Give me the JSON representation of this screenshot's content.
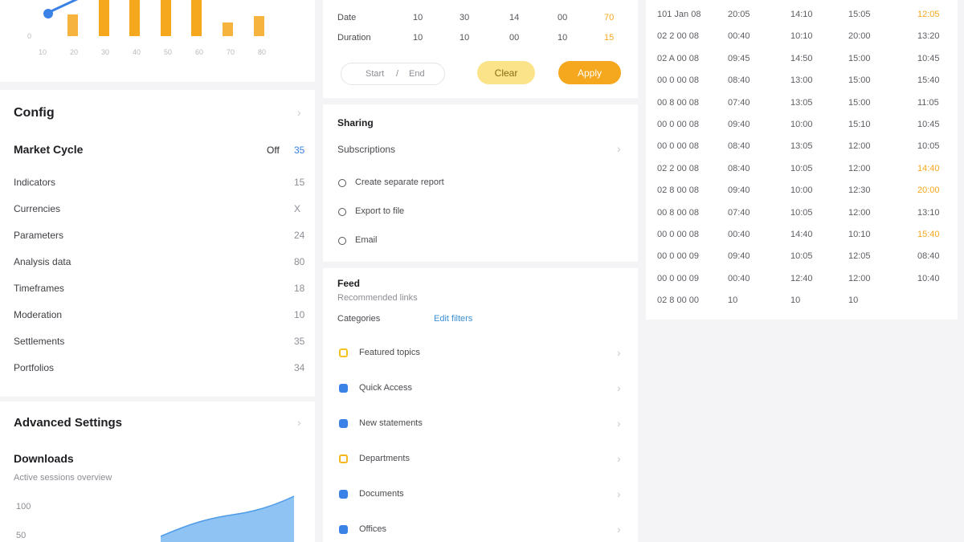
{
  "colors": {
    "accent": "#f5a71d",
    "accent_light": "#fbe38a",
    "blue": "#3b82e6",
    "area_blue": "#7ab8f2"
  },
  "top_chart": {
    "x_ticks": [
      "10",
      "20",
      "30",
      "40",
      "50",
      "60",
      "70",
      "80"
    ],
    "y_tick": "0"
  },
  "config": {
    "title": "Config",
    "header_label": "Market Cycle",
    "header_val1": "Off",
    "header_val2": "35",
    "items": [
      {
        "label": "Indicators",
        "value": "15"
      },
      {
        "label": "Currencies",
        "value": "X"
      },
      {
        "label": "Parameters",
        "value": "24"
      },
      {
        "label": "Analysis data",
        "value": "80"
      },
      {
        "label": "Timeframes",
        "value": "18"
      },
      {
        "label": "Moderation",
        "value": "10"
      },
      {
        "label": "Settlements",
        "value": "35"
      },
      {
        "label": "Portfolios",
        "value": "34"
      }
    ]
  },
  "advanced": {
    "title": "Advanced Settings",
    "subtitle": "Downloads",
    "caption": "Active sessions overview",
    "y_top": "100",
    "y_bottom": "50"
  },
  "mid_table": {
    "rows": [
      {
        "label": "Date",
        "cells": [
          "10",
          "30",
          "14",
          "00",
          "70"
        ]
      },
      {
        "label": "Duration",
        "cells": [
          "10",
          "10",
          "00",
          "10",
          "15"
        ]
      }
    ],
    "range_from": "Start",
    "range_to": "End",
    "btn_clear": "Clear",
    "btn_apply": "Apply"
  },
  "sharing": {
    "title": "Sharing",
    "subtitle": "Subscriptions",
    "options": [
      "Create separate report",
      "Export to file",
      "Email"
    ]
  },
  "feed": {
    "title": "Feed",
    "subtitle": "Recommended links",
    "link_label": "Categories",
    "link_value": "Edit filters",
    "items": [
      {
        "label": "Featured topics",
        "color": "#f5c21d"
      },
      {
        "label": "Quick Access",
        "color": "#3b82e6"
      },
      {
        "label": "New statements",
        "color": "#3b82e6"
      },
      {
        "label": "Departments",
        "color": "#f5b51d"
      },
      {
        "label": "Documents",
        "color": "#3b82e6"
      },
      {
        "label": "Offices",
        "color": "#3b82e6"
      }
    ]
  },
  "right_table": {
    "rows": [
      [
        "101 Jan 08",
        "20:05",
        "14:10",
        "15:05",
        "12:05"
      ],
      [
        "02 2 00 08",
        "00:40",
        "10:10",
        "20:00",
        "13:20"
      ],
      [
        "02 A 00 08",
        "09:45",
        "14:50",
        "15:00",
        "10:45"
      ],
      [
        "00 0 00 08",
        "08:40",
        "13:00",
        "15:00",
        "15:40"
      ],
      [
        "00 8 00 08",
        "07:40",
        "13:05",
        "15:00",
        "11:05"
      ],
      [
        "00 0 00 08",
        "09:40",
        "10:00",
        "15:10",
        "10:45"
      ],
      [
        "00 0 00 08",
        "08:40",
        "13:05",
        "12:00",
        "10:05"
      ],
      [
        "02 2 00 08",
        "08:40",
        "10:05",
        "12:00",
        "14:40"
      ],
      [
        "02 8 00 08",
        "09:40",
        "10:00",
        "12:30",
        "20:00"
      ],
      [
        "00 8 00 08",
        "07:40",
        "10:05",
        "12:00",
        "13:10"
      ],
      [
        "00 0 00 08",
        "00:40",
        "14:40",
        "10:10",
        "15:40"
      ],
      [
        "00 0 00 09",
        "09:40",
        "10:05",
        "12:05",
        "08:40"
      ],
      [
        "00 0 00 09",
        "00:40",
        "12:40",
        "12:00",
        "10:40"
      ],
      [
        "02 8 00 00",
        "10",
        "10",
        "10",
        ""
      ]
    ],
    "highlight_rows": [
      0,
      7,
      8,
      10
    ]
  }
}
